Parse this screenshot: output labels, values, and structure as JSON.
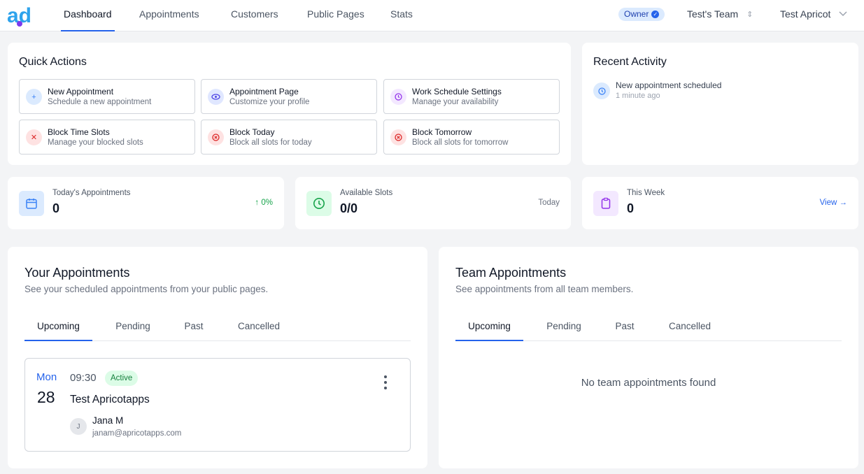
{
  "nav": {
    "logo_text": "ad",
    "tabs": [
      {
        "label": "Dashboard",
        "active": true
      },
      {
        "label": "Appointments",
        "active": false
      },
      {
        "label": "Customers",
        "active": false
      },
      {
        "label": "Public Pages",
        "active": false
      },
      {
        "label": "Stats",
        "active": false
      }
    ],
    "role_badge": "Owner",
    "team": "Test's Team",
    "user": "Test Apricot"
  },
  "quick_actions": {
    "title": "Quick Actions",
    "items": [
      {
        "label": "New Appointment",
        "sub": "Schedule a new appointment",
        "icon": "plus-icon"
      },
      {
        "label": "Appointment Page",
        "sub": "Customize your profile",
        "icon": "eye-icon"
      },
      {
        "label": "Work Schedule Settings",
        "sub": "Manage your availability",
        "icon": "clock-icon"
      },
      {
        "label": "Block Time Slots",
        "sub": "Manage your blocked slots",
        "icon": "x-icon"
      },
      {
        "label": "Block Today",
        "sub": "Block all slots for today",
        "icon": "block-icon"
      },
      {
        "label": "Block Tomorrow",
        "sub": "Block all slots for tomorrow",
        "icon": "block-icon"
      }
    ]
  },
  "recent_activity": {
    "title": "Recent Activity",
    "items": [
      {
        "text": "New appointment scheduled",
        "time": "1 minute ago",
        "icon": "clock-icon"
      }
    ]
  },
  "stats": [
    {
      "label": "Today's Appointments",
      "value": "0",
      "right": "↑ 0%",
      "icon": "calendar-icon",
      "accent": "#3b82f6"
    },
    {
      "label": "Available Slots",
      "value": "0/0",
      "right": "Today",
      "icon": "clock-icon",
      "accent": "#16a34a"
    },
    {
      "label": "This Week",
      "value": "0",
      "right": "View →",
      "icon": "clipboard-icon",
      "accent": "#9333ea"
    }
  ],
  "your_appointments": {
    "title": "Your Appointments",
    "subtitle": "See your scheduled appointments from your public pages.",
    "tabs": [
      "Upcoming",
      "Pending",
      "Past",
      "Cancelled"
    ],
    "active_tab": "Upcoming",
    "items": [
      {
        "day": "Mon",
        "date": "28",
        "time": "09:30",
        "status": "Active",
        "title": "Test Apricotapps",
        "avatar": "J",
        "person": "Jana M",
        "email": "janam@apricotapps.com"
      }
    ]
  },
  "team_appointments": {
    "title": "Team Appointments",
    "subtitle": "See appointments from all team members.",
    "tabs": [
      "Upcoming",
      "Pending",
      "Past",
      "Cancelled"
    ],
    "active_tab": "Upcoming",
    "empty_text": "No team appointments found"
  },
  "colors": {
    "accent": "#2563eb",
    "background": "#f3f4f6",
    "active_badge": "#dcfce7",
    "up_trend": "#16a34a"
  }
}
